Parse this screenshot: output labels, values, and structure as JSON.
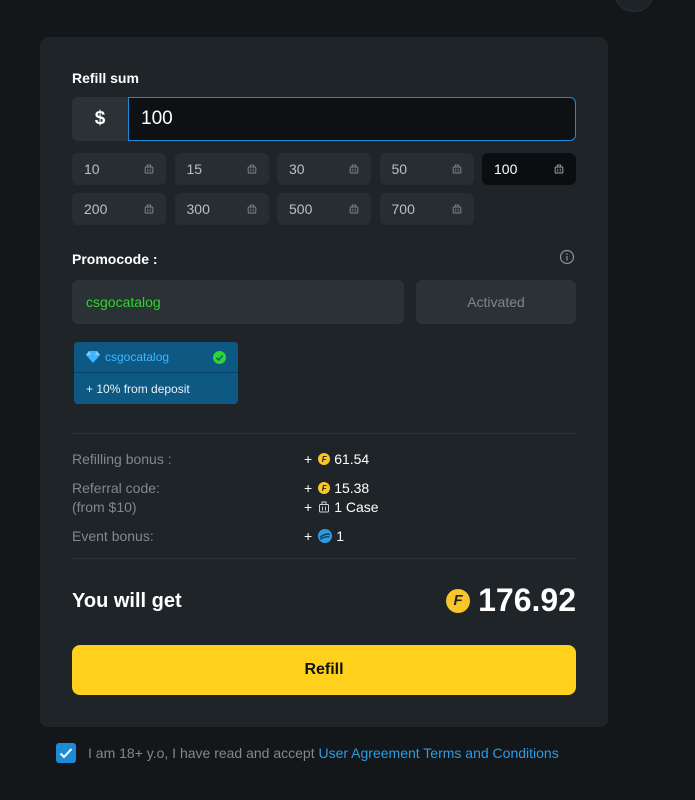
{
  "refill": {
    "label": "Refill sum",
    "currency_symbol": "$",
    "value": "100",
    "amounts": [
      {
        "label": "10",
        "selected": false
      },
      {
        "label": "15",
        "selected": false
      },
      {
        "label": "30",
        "selected": false
      },
      {
        "label": "50",
        "selected": false
      },
      {
        "label": "100",
        "selected": true
      },
      {
        "label": "200",
        "selected": false
      },
      {
        "label": "300",
        "selected": false
      },
      {
        "label": "500",
        "selected": false
      },
      {
        "label": "700",
        "selected": false
      }
    ]
  },
  "promo": {
    "label": "Promocode :",
    "value": "csgocatalog",
    "button_label": "Activated",
    "tag_code": "csgocatalog",
    "tag_bonus": "+ 10% from deposit"
  },
  "bonuses": {
    "refilling_label": "Refilling bonus :",
    "refilling_value": "61.54",
    "referral_label": "Referral code:",
    "referral_sub": "(from $10)",
    "referral_value": "15.38",
    "referral_case": "1 Case",
    "event_label": "Event bonus:",
    "event_value": "1",
    "plus": "+"
  },
  "total": {
    "label": "You will get",
    "value": "176.92"
  },
  "refill_button": "Refill",
  "agreement": {
    "text": "I am 18+ y.o, I have read and accept",
    "link": "User Agreement Terms and Conditions",
    "checked": true
  },
  "coin_letter": "F",
  "colors": {
    "accent_blue": "#1f8ad6",
    "button_yellow": "#ffd11c",
    "promo_green": "#2fd52f",
    "coin_gold": "#f7c62a"
  }
}
